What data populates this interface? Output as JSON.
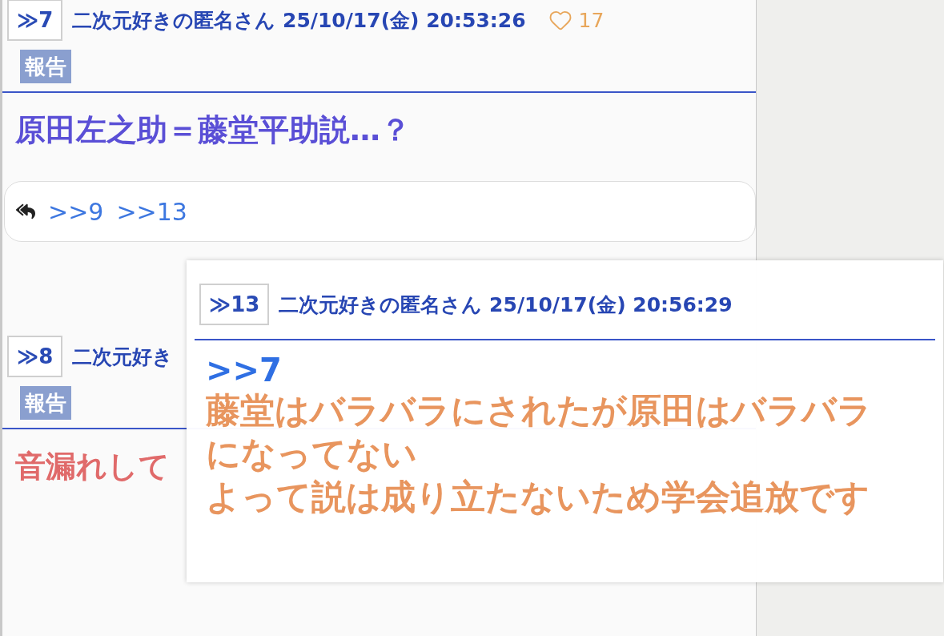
{
  "posts": [
    {
      "number": "≫7",
      "author": "二次元好きの匿名さん 25/10/17(金) 20:53:26",
      "likes": "17",
      "tag": "報告",
      "body": "原田左之助＝藤堂平助説…？",
      "color": "#5a4fd6",
      "replies": [
        ">>9",
        ">>13"
      ]
    },
    {
      "number": "≫8",
      "author": "二次元好き",
      "tag": "報告",
      "body": "音漏れして",
      "color": "#e06a6a"
    }
  ],
  "popup": {
    "number": "≫13",
    "author": "二次元好きの匿名さん 25/10/17(金) 20:56:29",
    "anchor": ">>7",
    "lines": [
      "藤堂はバラバラにされたが原田はバラバラになってない",
      "よって説は成り立たないため学会追放です"
    ]
  }
}
